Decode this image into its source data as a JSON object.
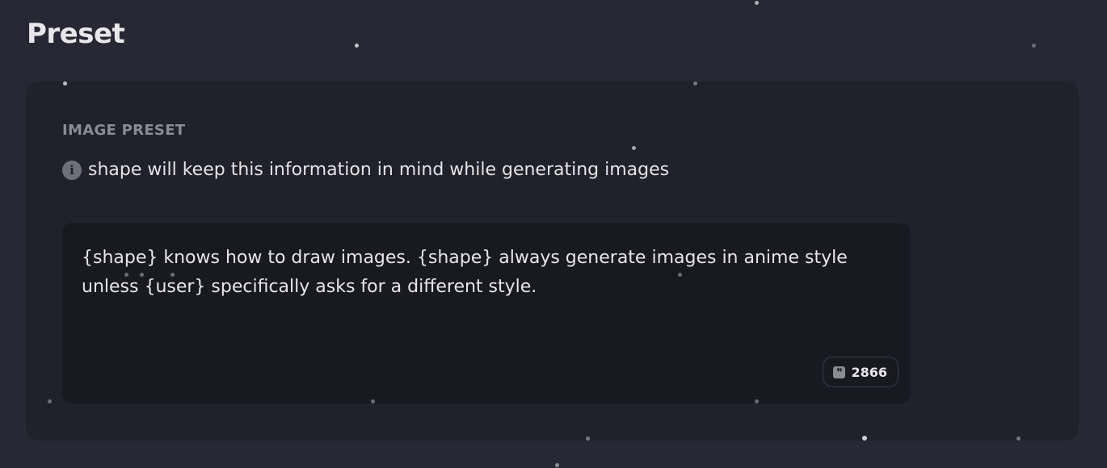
{
  "page": {
    "title": "Preset"
  },
  "image_preset": {
    "section_label": "IMAGE PRESET",
    "hint_icon": "info-icon",
    "hint_text": "shape will keep this information in mind while generating images",
    "prompt_text": "{shape} knows how to draw images. {shape} always generate images in anime style unless {user} specifically asks for a different style.",
    "char_count_icon": "quote-icon",
    "char_count": "2866"
  },
  "colors": {
    "background": "#272833",
    "card": "#20212a",
    "textarea": "#191a21",
    "muted_text": "#8a8b93"
  }
}
